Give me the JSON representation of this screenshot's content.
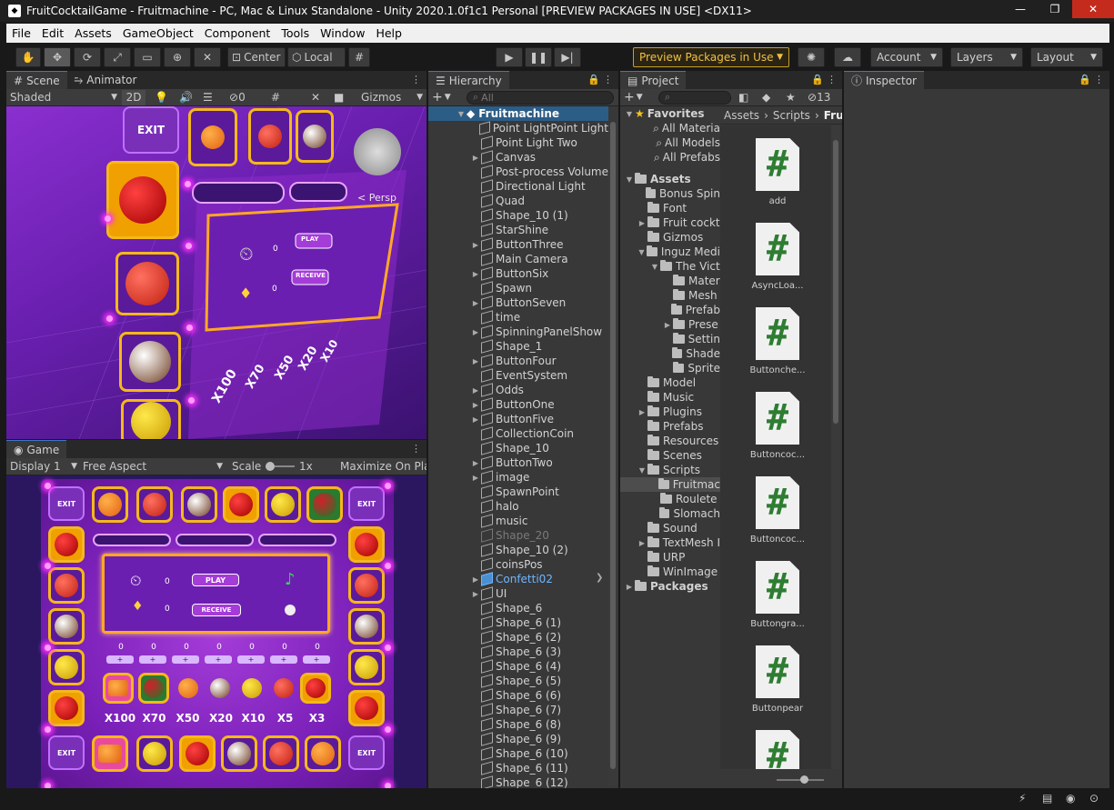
{
  "window": {
    "title": "FruitCocktailGame - Fruitmachine - PC, Mac & Linux Standalone - Unity 2020.1.0f1c1 Personal [PREVIEW PACKAGES IN USE] <DX11>",
    "minimize": "—",
    "maximize": "❐",
    "close": "✕"
  },
  "menu": [
    "File",
    "Edit",
    "Assets",
    "GameObject",
    "Component",
    "Tools",
    "Window",
    "Help"
  ],
  "toolbar": {
    "center": "Center",
    "local": "Local",
    "preview": "Preview Packages in Use",
    "account": "Account",
    "layers": "Layers",
    "layout": "Layout"
  },
  "scene": {
    "tab": "Scene",
    "tab2": "Animator",
    "shading": "Shaded",
    "mode2d": "2D",
    "gizmos": "Gizmos",
    "persp": "< Persp",
    "counter": "0",
    "exit": "EXIT",
    "play": "PLAY",
    "receive": "RECEIVE",
    "zero": "0"
  },
  "game": {
    "tab": "Game",
    "display": "Display 1",
    "aspect": "Free Aspect",
    "scale_label": "Scale",
    "scale_value": "1x",
    "maximize": "Maximize On Pla",
    "exit": "EXIT",
    "play": "PLAY",
    "receive": "RECEIVE",
    "zero": "0",
    "multipliers": [
      "X100",
      "X70",
      "X50",
      "X20",
      "X10",
      "X5",
      "X3"
    ],
    "counters": [
      "0",
      "0",
      "0",
      "0",
      "0",
      "0",
      "0"
    ]
  },
  "hierarchy": {
    "tab": "Hierarchy",
    "search": "All",
    "root": "Fruitmachine",
    "items": [
      {
        "label": "Point LightPoint Light",
        "arrow": ""
      },
      {
        "label": "Point Light Two",
        "arrow": ""
      },
      {
        "label": "Canvas",
        "arrow": "▶"
      },
      {
        "label": "Post-process Volume",
        "arrow": ""
      },
      {
        "label": "Directional Light",
        "arrow": ""
      },
      {
        "label": "Quad",
        "arrow": ""
      },
      {
        "label": "Shape_10 (1)",
        "arrow": ""
      },
      {
        "label": "StarShine",
        "arrow": ""
      },
      {
        "label": "ButtonThree",
        "arrow": "▶"
      },
      {
        "label": "Main Camera",
        "arrow": ""
      },
      {
        "label": "ButtonSix",
        "arrow": "▶"
      },
      {
        "label": "Spawn",
        "arrow": ""
      },
      {
        "label": "ButtonSeven",
        "arrow": "▶"
      },
      {
        "label": "time",
        "arrow": ""
      },
      {
        "label": "SpinningPanelShow",
        "arrow": "▶"
      },
      {
        "label": "Shape_1",
        "arrow": ""
      },
      {
        "label": "ButtonFour",
        "arrow": "▶"
      },
      {
        "label": "EventSystem",
        "arrow": ""
      },
      {
        "label": "Odds",
        "arrow": "▶"
      },
      {
        "label": "ButtonOne",
        "arrow": "▶"
      },
      {
        "label": "ButtonFive",
        "arrow": "▶"
      },
      {
        "label": "CollectionCoin",
        "arrow": ""
      },
      {
        "label": "Shape_10",
        "arrow": ""
      },
      {
        "label": "ButtonTwo",
        "arrow": "▶"
      },
      {
        "label": "image",
        "arrow": "▶"
      },
      {
        "label": "SpawnPoint",
        "arrow": ""
      },
      {
        "label": "halo",
        "arrow": ""
      },
      {
        "label": "music",
        "arrow": ""
      },
      {
        "label": "Shape_20",
        "arrow": "",
        "state": "dim"
      },
      {
        "label": "Shape_10 (2)",
        "arrow": ""
      },
      {
        "label": "coinsPos",
        "arrow": ""
      },
      {
        "label": "Confetti02",
        "arrow": "▶",
        "state": "prefab"
      },
      {
        "label": "UI",
        "arrow": "▶"
      },
      {
        "label": "Shape_6",
        "arrow": ""
      },
      {
        "label": "Shape_6 (1)",
        "arrow": ""
      },
      {
        "label": "Shape_6 (2)",
        "arrow": ""
      },
      {
        "label": "Shape_6 (3)",
        "arrow": ""
      },
      {
        "label": "Shape_6 (4)",
        "arrow": ""
      },
      {
        "label": "Shape_6 (5)",
        "arrow": ""
      },
      {
        "label": "Shape_6 (6)",
        "arrow": ""
      },
      {
        "label": "Shape_6 (7)",
        "arrow": ""
      },
      {
        "label": "Shape_6 (8)",
        "arrow": ""
      },
      {
        "label": "Shape_6 (9)",
        "arrow": ""
      },
      {
        "label": "Shape_6 (10)",
        "arrow": ""
      },
      {
        "label": "Shape_6 (11)",
        "arrow": ""
      },
      {
        "label": "Shape_6 (12)",
        "arrow": ""
      }
    ]
  },
  "project": {
    "tab": "Project",
    "count": "13",
    "breadcrumb": [
      "Assets",
      "Scripts",
      "Fru"
    ],
    "tree": [
      {
        "label": "Favorites",
        "arrow": "▼",
        "kind": "star",
        "bold": true
      },
      {
        "label": "All Materia",
        "arrow": "",
        "kind": "search"
      },
      {
        "label": "All Models",
        "arrow": "",
        "kind": "search"
      },
      {
        "label": "All Prefabs",
        "arrow": "",
        "kind": "search"
      },
      {
        "label": "",
        "arrow": "",
        "kind": "gap"
      },
      {
        "label": "Assets",
        "arrow": "▼",
        "kind": "folder",
        "bold": true
      },
      {
        "label": "Bonus Spin",
        "arrow": "",
        "kind": "folder"
      },
      {
        "label": "Font",
        "arrow": "",
        "kind": "folder"
      },
      {
        "label": "Fruit cockt",
        "arrow": "▶",
        "kind": "folder"
      },
      {
        "label": "Gizmos",
        "arrow": "",
        "kind": "folder"
      },
      {
        "label": "Inguz Medi",
        "arrow": "▼",
        "kind": "folder"
      },
      {
        "label": "The Vict",
        "arrow": "▼",
        "kind": "folder",
        "indent": 1
      },
      {
        "label": "Mater",
        "arrow": "",
        "kind": "folder",
        "indent": 2
      },
      {
        "label": "Mesh",
        "arrow": "",
        "kind": "folder",
        "indent": 2
      },
      {
        "label": "Prefab",
        "arrow": "",
        "kind": "folder",
        "indent": 2
      },
      {
        "label": "Prese",
        "arrow": "▶",
        "kind": "folder",
        "indent": 2
      },
      {
        "label": "Settin",
        "arrow": "",
        "kind": "folder",
        "indent": 2
      },
      {
        "label": "Shade",
        "arrow": "",
        "kind": "folder",
        "indent": 2
      },
      {
        "label": "Sprite",
        "arrow": "",
        "kind": "folder",
        "indent": 2
      },
      {
        "label": "Model",
        "arrow": "",
        "kind": "folder"
      },
      {
        "label": "Music",
        "arrow": "",
        "kind": "folder"
      },
      {
        "label": "Plugins",
        "arrow": "▶",
        "kind": "folder"
      },
      {
        "label": "Prefabs",
        "arrow": "",
        "kind": "folder"
      },
      {
        "label": "Resources",
        "arrow": "",
        "kind": "folder"
      },
      {
        "label": "Scenes",
        "arrow": "",
        "kind": "folder"
      },
      {
        "label": "Scripts",
        "arrow": "▼",
        "kind": "folder"
      },
      {
        "label": "Fruitmac",
        "arrow": "",
        "kind": "folder",
        "indent": 1,
        "sel": true
      },
      {
        "label": "Roulete",
        "arrow": "",
        "kind": "folder",
        "indent": 1
      },
      {
        "label": "Slomach",
        "arrow": "",
        "kind": "folder",
        "indent": 1
      },
      {
        "label": "Sound",
        "arrow": "",
        "kind": "folder"
      },
      {
        "label": "TextMesh I",
        "arrow": "▶",
        "kind": "folder"
      },
      {
        "label": "URP",
        "arrow": "",
        "kind": "folder"
      },
      {
        "label": "WinImage",
        "arrow": "",
        "kind": "folder"
      },
      {
        "label": "Packages",
        "arrow": "▶",
        "kind": "folder",
        "bold": true,
        "root": true
      }
    ],
    "assets": [
      "add",
      "AsyncLoa...",
      "Buttonche...",
      "Buttoncoc...",
      "Buttoncoc...",
      "Buttongra...",
      "Buttonpear",
      ""
    ],
    "asset_glyph": "#"
  },
  "inspector": {
    "tab": "Inspector"
  }
}
